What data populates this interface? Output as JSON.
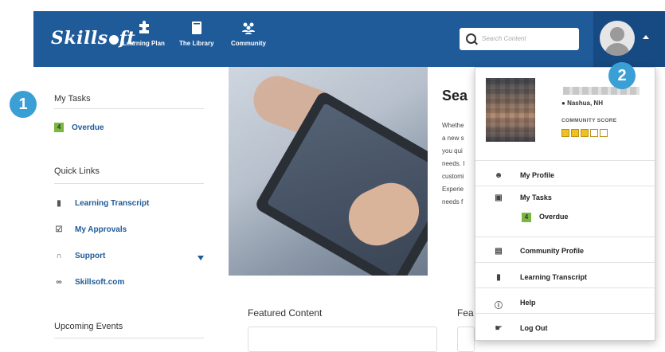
{
  "brand": {
    "logo_text_a": "Skills",
    "logo_text_b": "ft",
    "bar_color": "#1f5a99"
  },
  "nav": [
    {
      "label": "Learning Plan",
      "icon": "puzzle-icon"
    },
    {
      "label": "The Library",
      "icon": "book-icon"
    },
    {
      "label": "Community",
      "icon": "people-icon"
    }
  ],
  "search": {
    "placeholder": "Search Content"
  },
  "sidebar": {
    "my_tasks_heading": "My Tasks",
    "overdue_count": "4",
    "overdue_label": "Overdue",
    "quick_links_heading": "Quick Links",
    "links": [
      {
        "label": "Learning Transcript",
        "icon": "transcript-icon"
      },
      {
        "label": "My Approvals",
        "icon": "checkbox-icon"
      },
      {
        "label": "Support",
        "icon": "headset-icon"
      },
      {
        "label": "Skillsoft.com",
        "icon": "link-icon"
      }
    ],
    "upcoming_heading": "Upcoming Events"
  },
  "main": {
    "hero_title": "Sea",
    "hero_text": [
      "Whethe",
      "a new s",
      "you qui",
      "needs. I",
      "customi",
      "Experie",
      "needs f"
    ],
    "featured_heading": "Featured Content",
    "featured_heading_2": "Fea"
  },
  "profile_menu": {
    "location": "Nashua, NH",
    "community_score_label": "COMMUNITY SCORE",
    "community_score": 3,
    "community_score_max": 5,
    "items": [
      {
        "label": "My Profile",
        "icon": "person-icon"
      },
      {
        "label": "My Tasks",
        "icon": "clipboard-icon"
      },
      {
        "label": "Community Profile",
        "icon": "id-card-icon"
      },
      {
        "label": "Learning Transcript",
        "icon": "transcript-icon"
      },
      {
        "label": "Help",
        "icon": "help-icon"
      },
      {
        "label": "Log Out",
        "icon": "logout-icon"
      }
    ],
    "tasks_overdue_count": "4",
    "tasks_overdue_label": "Overdue"
  },
  "callouts": {
    "one": "1",
    "two": "2",
    "color": "#3a9fd4"
  }
}
